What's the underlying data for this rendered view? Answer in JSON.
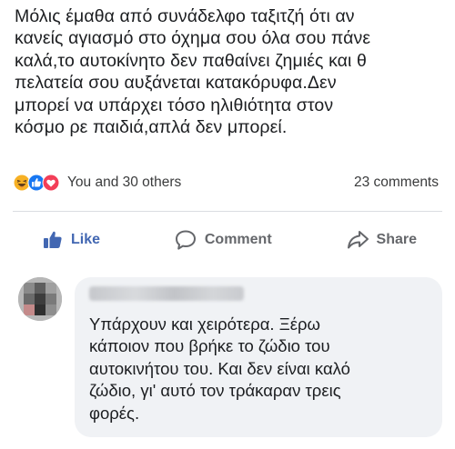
{
  "post": {
    "text": "Μόλις έμαθα από συνάδελφο ταξιτζή ότι αν\nκανείς αγιασμό στο όχημα σου  όλα σου πάνε\nκαλά,το αυτοκίνητο δεν παθαίνει ζημιές και θ\nπελατεία σου αυξάνεται κατακόρυφα.Δεν\nμπορεί να υπάρχει τόσο ηλιθιότητα στον\nκόσμο ρε παιδιά,απλά δεν μπορεί."
  },
  "stats": {
    "reaction_icons": [
      "haha-icon",
      "like-icon",
      "love-icon"
    ],
    "reactions_text": "You and 30 others",
    "comments_count": "23 comments"
  },
  "actions": {
    "like_label": "Like",
    "comment_label": "Comment",
    "share_label": "Share"
  },
  "comment": {
    "author": "",
    "text": "Υπάρχουν και χειρότερα. Ξέρω\nκάποιον που βρήκε το ζώδιο του\nαυτοκινήτου του. Και δεν είναι καλό\nζώδιο, γι' αυτό τον τράκαραν τρεις\nφορές."
  },
  "colors": {
    "like_blue": "#4267b2",
    "love_red": "#f33e58",
    "haha_yellow": "#f7b125",
    "muted_text": "#65676b",
    "bubble_bg": "#f0f2f5"
  }
}
